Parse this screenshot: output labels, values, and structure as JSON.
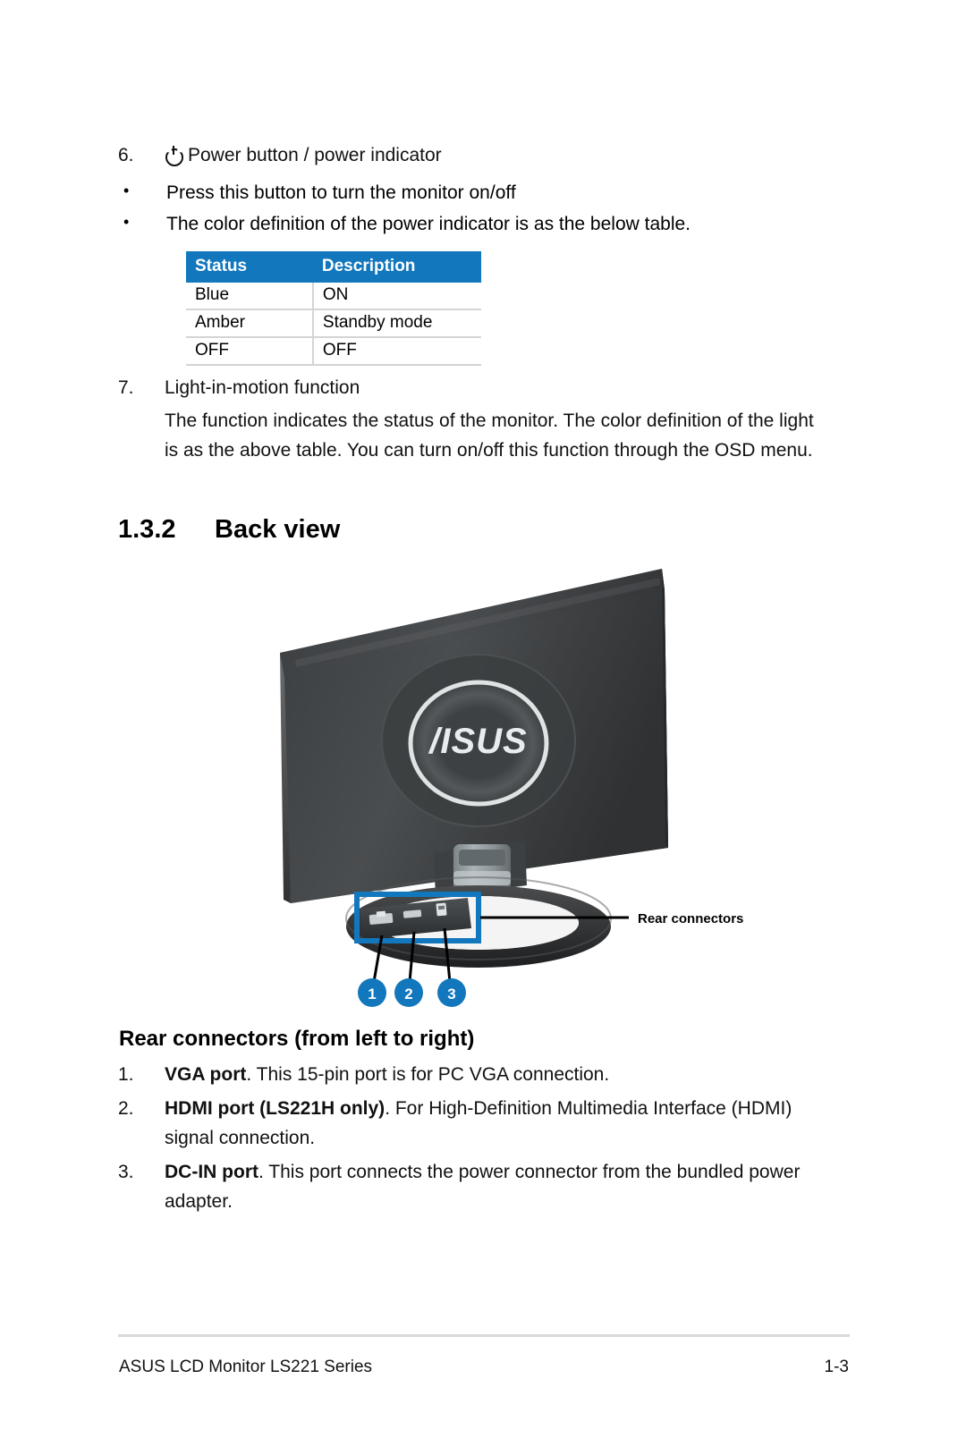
{
  "page": {
    "footer_left": "ASUS LCD Monitor LS221 Series",
    "footer_right": "1-3"
  },
  "item6": {
    "number": "6.",
    "icon": "power-icon",
    "title": "Power button / power indicator",
    "bullets": [
      "Press this button to turn the monitor on/off",
      "The color definition of the power indicator is as the below table."
    ]
  },
  "status_table": {
    "headers": [
      "Status",
      "Description"
    ],
    "header_bg": "#1277bc",
    "rows": [
      [
        "Blue",
        "ON"
      ],
      [
        "Amber",
        "Standby mode"
      ],
      [
        "OFF",
        "OFF"
      ]
    ]
  },
  "item7": {
    "number": "7.",
    "title": "Light-in-motion function",
    "body": "The function indicates the status of the monitor. The color definition of the light is as the above table. You can turn on/off this function through the OSD menu."
  },
  "section": {
    "number": "1.3.2",
    "title": "Back view"
  },
  "illustration": {
    "logo_text": "/ISUS",
    "callout_label": "Rear connectors",
    "badges": [
      "1",
      "2",
      "3"
    ],
    "highlight_color": "#1277bc"
  },
  "subheading": "Rear connectors (from left to right)",
  "connectors": [
    {
      "number": "1.",
      "bold": "VGA port",
      "text": ". This 15-pin port is for PC VGA connection."
    },
    {
      "number": "2.",
      "bold": "HDMI port (LS221H only)",
      "text": ". For High-Definition Multimedia Interface (HDMI) signal connection."
    },
    {
      "number": "3.",
      "bold": "DC-IN port",
      "text": ". This port connects the power connector from the bundled power adapter."
    }
  ]
}
